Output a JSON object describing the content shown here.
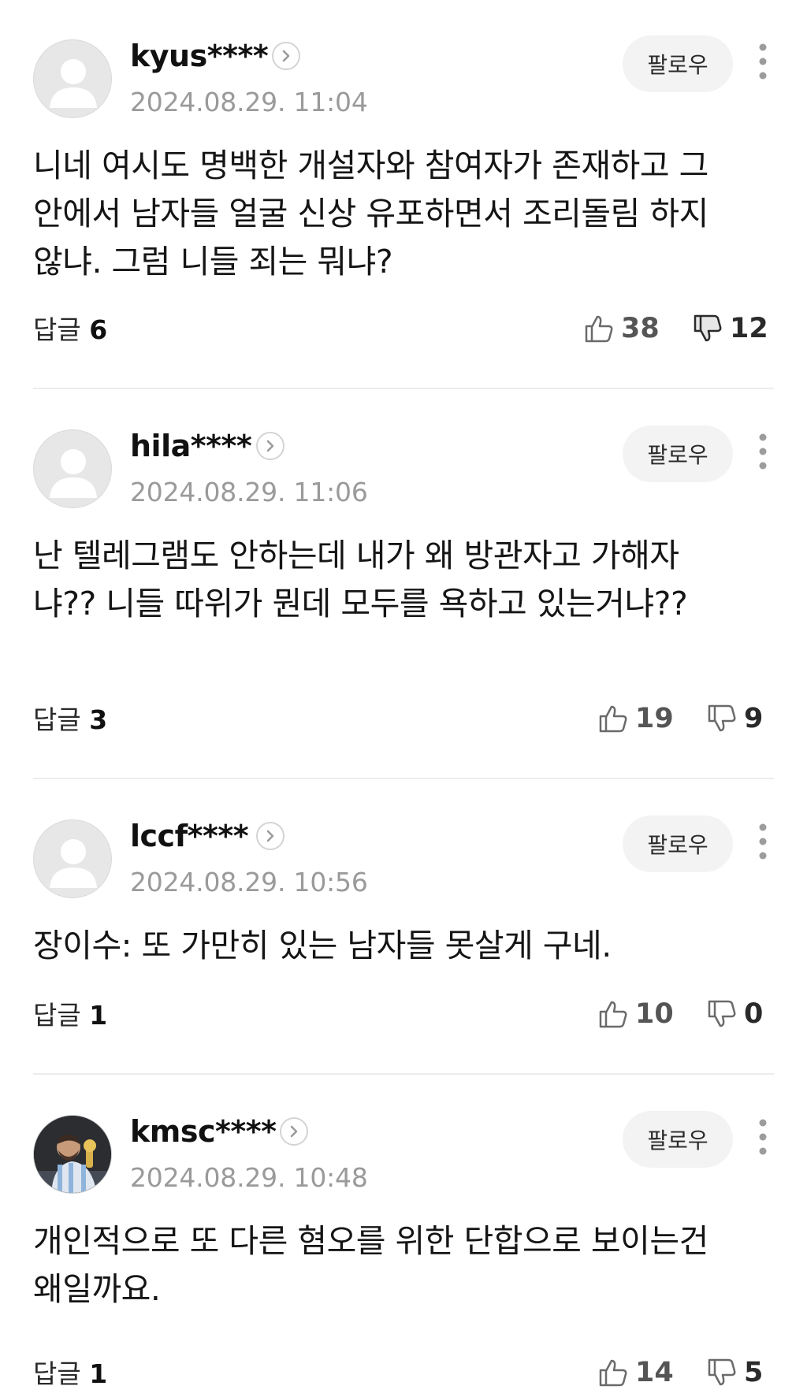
{
  "comments": [
    {
      "username": "kyus****",
      "timestamp": "2024.08.29. 11:04",
      "follow_label": "팔로우",
      "content": "니네 여시도 명백한 개설자와 참여자가 존재하고 그 안에서 남자들 얼굴 신상 유포하면서 조리돌림 하지않냐. 그럼 니들 죄는 뭐냐?",
      "reply_label": "답글",
      "reply_count": "6",
      "likes": "38",
      "dislikes": "12",
      "avatar": "default-avatar-icon"
    },
    {
      "username": "hila****",
      "timestamp": "2024.08.29. 11:06",
      "follow_label": "팔로우",
      "content": "난 텔레그램도 안하는데 내가 왜 방관자고 가해자냐?? 니들 따위가 뭔데 모두를 욕하고 있는거냐??",
      "reply_label": "답글",
      "reply_count": "3",
      "likes": "19",
      "dislikes": "9",
      "avatar": "default-avatar-icon"
    },
    {
      "username": "lccf****",
      "timestamp": "2024.08.29. 10:56",
      "follow_label": "팔로우",
      "content": "장이수: 또 가만히 있는 남자들 못살게 구네.",
      "reply_label": "답글",
      "reply_count": "1",
      "likes": "10",
      "dislikes": "0",
      "avatar": "default-avatar-icon"
    },
    {
      "username": "kmsc****",
      "timestamp": "2024.08.29. 10:48",
      "follow_label": "팔로우",
      "content": "개인적으로 또 다른 혐오를 위한 단합으로 보이는건 왜일까요.",
      "reply_label": "답글",
      "reply_count": "1",
      "likes": "14",
      "dislikes": "5",
      "avatar": "photo-avatar"
    }
  ],
  "colors": {
    "text": "#151515",
    "muted": "#9a9a9a",
    "divider": "#ececec",
    "button_bg": "#f3f3f3"
  }
}
